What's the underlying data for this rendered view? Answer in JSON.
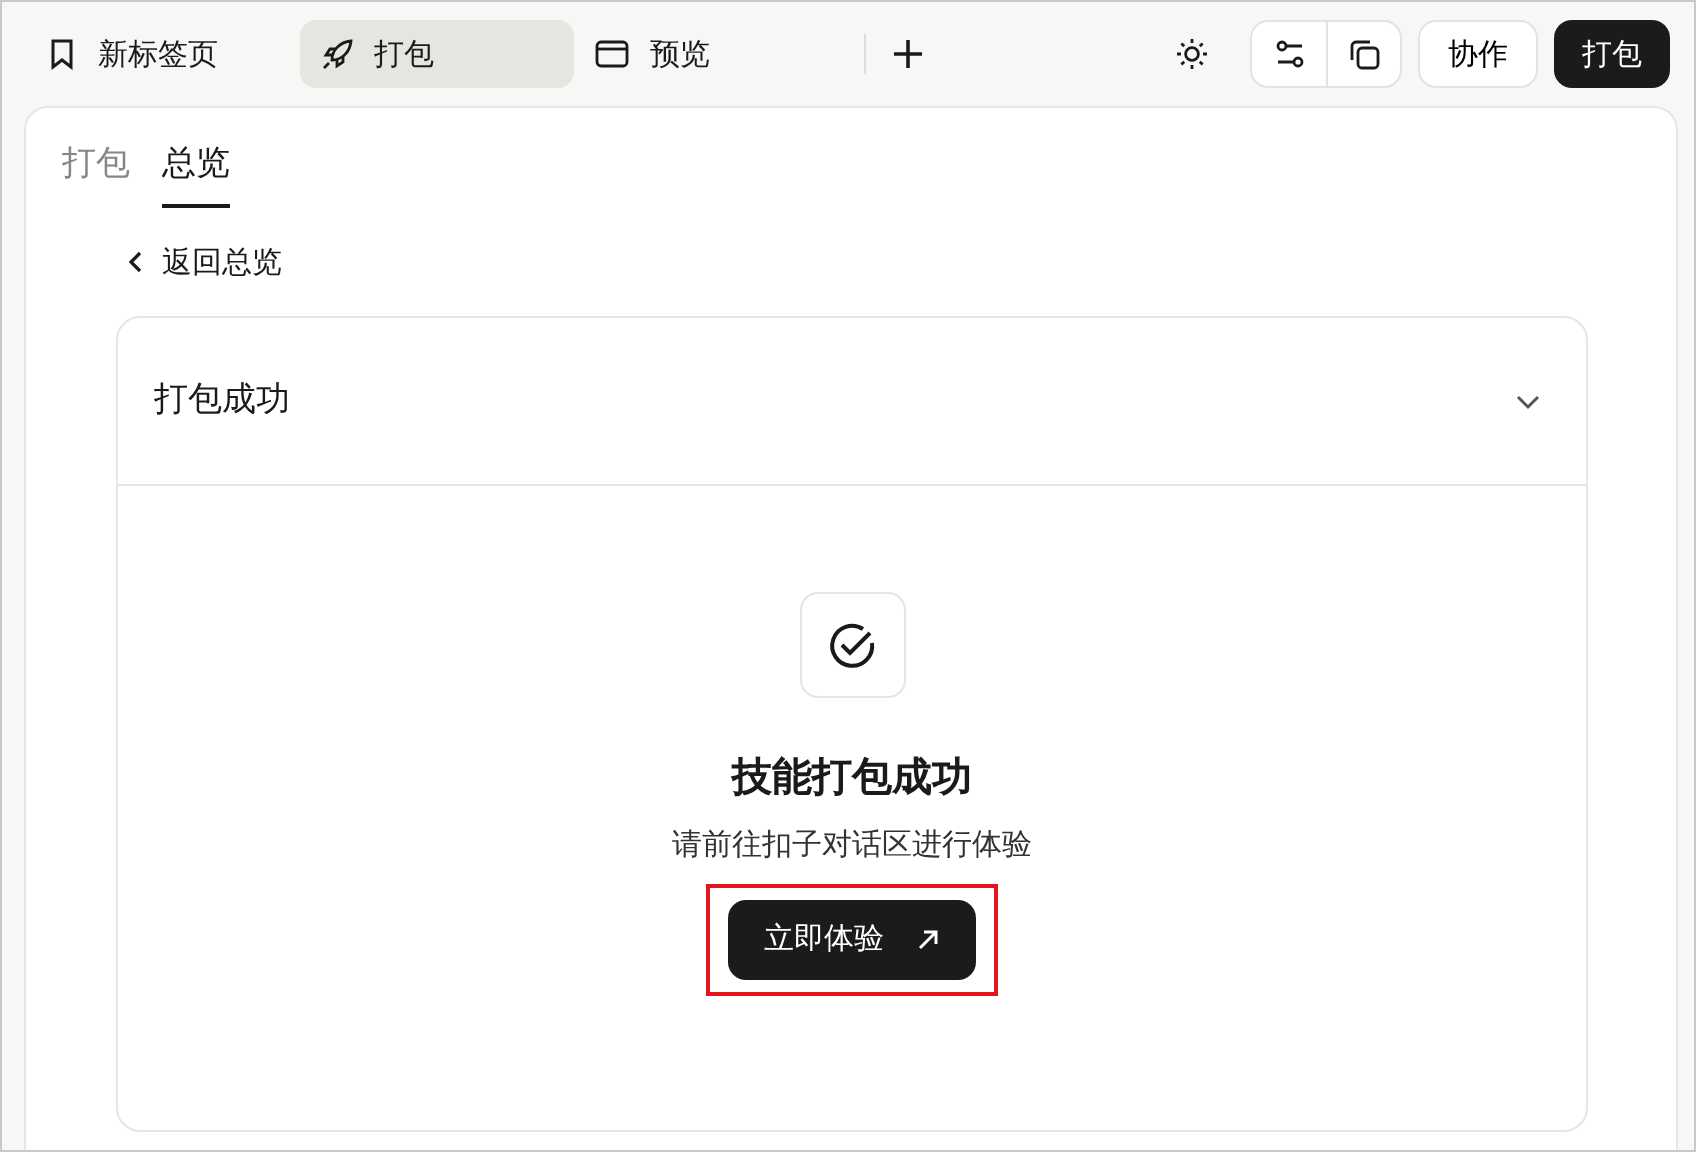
{
  "top_tabs": [
    {
      "label": "新标签页",
      "selected": false
    },
    {
      "label": "打包",
      "selected": true
    },
    {
      "label": "预览",
      "selected": false
    }
  ],
  "actions": {
    "collaborate": "协作",
    "publish": "打包"
  },
  "sub_tabs": [
    {
      "label": "打包",
      "selected": false
    },
    {
      "label": "总览",
      "selected": true
    }
  ],
  "back_link": "返回总览",
  "panel": {
    "title": "打包成功",
    "heading": "技能打包成功",
    "message": "请前往扣子对话区进行体验",
    "button": "立即体验",
    "highlighted": true
  }
}
